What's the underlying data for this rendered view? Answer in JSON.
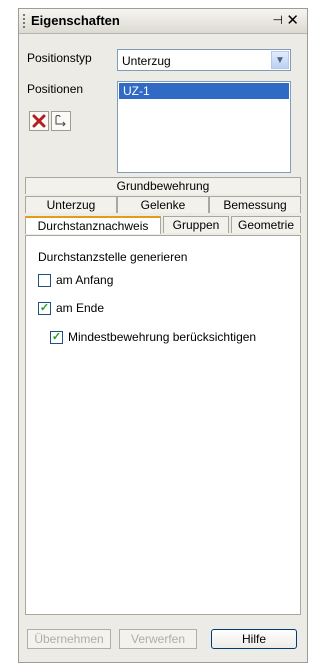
{
  "panel": {
    "title": "Eigenschaften",
    "pin_glyph": "⊣",
    "close_glyph": "✕"
  },
  "position_type": {
    "label": "Positionstyp",
    "value": "Unterzug"
  },
  "positions": {
    "label": "Positionen",
    "items": [
      "UZ-1"
    ]
  },
  "tabs": {
    "row1": [
      "Grundbewehrung"
    ],
    "row2": [
      "Unterzug",
      "Gelenke",
      "Bemessung"
    ],
    "row3": [
      "Durchstanznachweis",
      "Gruppen",
      "Geometrie"
    ],
    "active": "Durchstanznachweis"
  },
  "content": {
    "section_label": "Durchstanzstelle generieren",
    "checkboxes": [
      {
        "label": "am Anfang",
        "checked": false
      },
      {
        "label": "am Ende",
        "checked": true
      },
      {
        "label": "Mindestbewehrung berücksichtigen",
        "checked": true
      }
    ]
  },
  "buttons": {
    "apply": "Übernehmen",
    "discard": "Verwerfen",
    "help": "Hilfe"
  },
  "colors": {
    "selection": "#316ac5",
    "active_tab_accent": "#e59b1a",
    "delete_icon": "#b41e1e",
    "check": "#21a121"
  }
}
